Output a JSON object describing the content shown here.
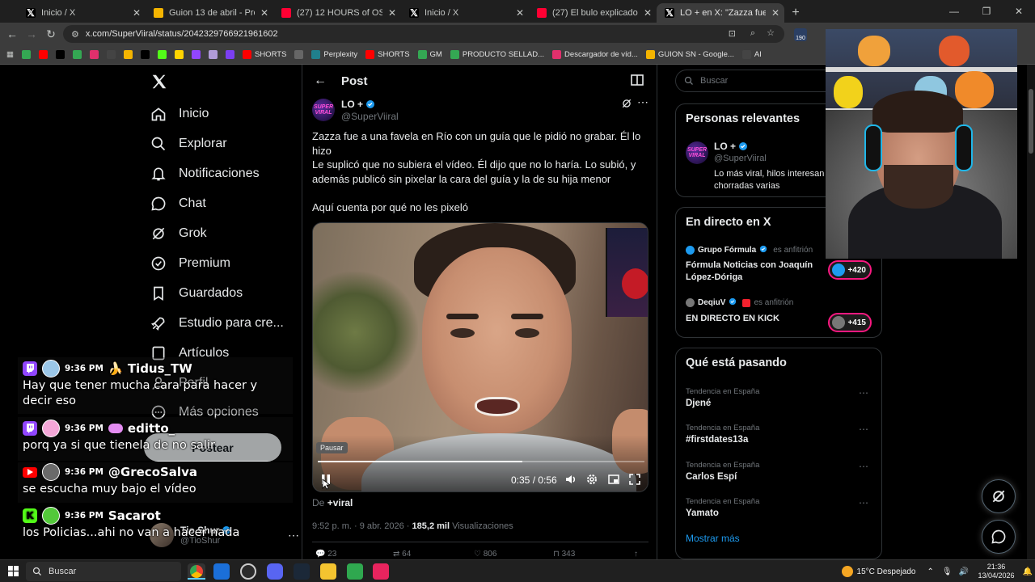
{
  "browser": {
    "tabs": [
      {
        "title": "Inicio / X",
        "icon": "x-logo-icon",
        "active": false
      },
      {
        "title": "Guion 13 de abril - Presentacio",
        "icon": "google-slides-icon",
        "active": false
      },
      {
        "title": "(27) 12 HOURS of OSRS mu",
        "icon": "youtube-icon",
        "active": false
      },
      {
        "title": "Inicio / X",
        "icon": "x-logo-icon",
        "active": false
      },
      {
        "title": "(27) El bulo explicado. - YouTub",
        "icon": "youtube-icon",
        "active": false
      },
      {
        "title": "LO + en X: \"Zazza fue a una",
        "icon": "x-logo-icon",
        "active": true
      }
    ],
    "url": "x.com/SuperViiral/status/2042329766921961602",
    "bookmarks": [
      {
        "label": "",
        "color": "#34a853"
      },
      {
        "label": "",
        "color": "#ff0000"
      },
      {
        "label": "",
        "color": "#000000"
      },
      {
        "label": "",
        "color": "#34a853"
      },
      {
        "label": "",
        "color": "#e1306c"
      },
      {
        "label": "",
        "color": "#444444"
      },
      {
        "label": "",
        "color": "#f4b400"
      },
      {
        "label": "",
        "color": "#000000"
      },
      {
        "label": "",
        "color": "#53fc18"
      },
      {
        "label": "",
        "color": "#ffd400"
      },
      {
        "label": "",
        "color": "#9146ff"
      },
      {
        "label": "",
        "color": "#b19cd9"
      },
      {
        "label": "",
        "color": "#7b3ff2"
      },
      {
        "label": "SHORTS",
        "color": "#ff0000"
      },
      {
        "label": "",
        "color": "#666666"
      },
      {
        "label": "Perplexity",
        "color": "#20808d"
      },
      {
        "label": "SHORTS",
        "color": "#ff0000"
      },
      {
        "label": "GM",
        "color": "#34a853"
      },
      {
        "label": "PRODUCTO SELLAD...",
        "color": "#34a853"
      },
      {
        "label": "Descargador de víd...",
        "color": "#e1306c"
      },
      {
        "label": "GUION SN - Google...",
        "color": "#f4b400"
      },
      {
        "label": "AI",
        "color": "#444444"
      }
    ],
    "extension_badge": "190"
  },
  "nav": {
    "items": [
      {
        "label": "Inicio",
        "icon": "home-icon"
      },
      {
        "label": "Explorar",
        "icon": "search-icon"
      },
      {
        "label": "Notificaciones",
        "icon": "bell-icon"
      },
      {
        "label": "Chat",
        "icon": "chat-icon"
      },
      {
        "label": "Grok",
        "icon": "grok-icon"
      },
      {
        "label": "Premium",
        "icon": "premium-icon"
      },
      {
        "label": "Guardados",
        "icon": "bookmark-icon"
      },
      {
        "label": "Estudio para cre...",
        "icon": "rocket-icon"
      },
      {
        "label": "Artículos",
        "icon": "article-icon"
      },
      {
        "label": "Perfil",
        "icon": "profile-icon"
      },
      {
        "label": "Más opciones",
        "icon": "more-circle-icon"
      }
    ],
    "post_button": "Postear",
    "account_name": "Tio Shur",
    "account_handle": "@TioShur"
  },
  "post": {
    "header": "Post",
    "author_name": "LO +",
    "author_handle": "@SuperViiral",
    "avatar_text": "SUPER VIRAL",
    "text1": "Zazza fue a una favela en Río con un guía que le pidió no grabar. Él lo hizo",
    "text2": "Le suplicó que no subiera el vídeo. Él dijo que no lo haría. Lo subió, y además publicó sin pixelar la cara del guía y la de su hija menor",
    "text3": "Aquí cuenta por qué no les pixeló",
    "video": {
      "tooltip": "Pausar",
      "time": "0:35 / 0:56",
      "progress": 0.625
    },
    "via_prefix": "De",
    "via_name": "+viral",
    "timestamp": "9:52 p. m. · 9 abr. 2026 ·",
    "views_count": "185,2 mil",
    "views_label": "Visualizaciones",
    "stats": {
      "replies": "23",
      "reposts": "64",
      "likes": "806",
      "bookmarks": "343"
    }
  },
  "sidebar": {
    "search_placeholder": "Buscar",
    "relevant": {
      "title": "Personas relevantes",
      "name": "LO +",
      "handle": "@SuperViiral",
      "bio": "Lo más viral, hilos interesan chorradas varias"
    },
    "live": {
      "title": "En directo en X",
      "items": [
        {
          "host": "Grupo Fórmula",
          "host_suffix": "es anfitrión",
          "title": "Fórmula Noticias con Joaquín López-Dóriga",
          "count": "+420"
        },
        {
          "host": "DeqiuV",
          "host_suffix": "es anfitrión",
          "title": "EN DIRECTO EN KICK",
          "count": "+415"
        }
      ]
    },
    "trending": {
      "title": "Qué está pasando",
      "items": [
        {
          "context": "Tendencia en España",
          "topic": "Djené"
        },
        {
          "context": "Tendencia en España",
          "topic": "#firstdates13a"
        },
        {
          "context": "Tendencia en España",
          "topic": "Carlos Espí"
        },
        {
          "context": "Tendencia en España",
          "topic": "Yamato"
        }
      ],
      "show_more": "Mostrar más"
    }
  },
  "chat": [
    {
      "platform": "twitch",
      "time": "9:36 PM",
      "user": "🍌 Tidus_TW",
      "message": "Hay que tener mucha cara para hacer y decir eso"
    },
    {
      "platform": "twitch",
      "time": "9:36 PM",
      "user": "editto_",
      "message": "porq ya si que tienela de no salir"
    },
    {
      "platform": "youtube",
      "time": "9:36 PM",
      "user": "@GrecoSalva",
      "message": "se escucha muy bajo el vídeo"
    },
    {
      "platform": "kick",
      "time": "9:36 PM",
      "user": "Sacarot",
      "message": "los Policias...ahi no van a hacer nada"
    }
  ],
  "taskbar": {
    "search_label": "Buscar",
    "weather": "15°C Despejado",
    "time": "21:36",
    "date": "13/04/2026"
  }
}
